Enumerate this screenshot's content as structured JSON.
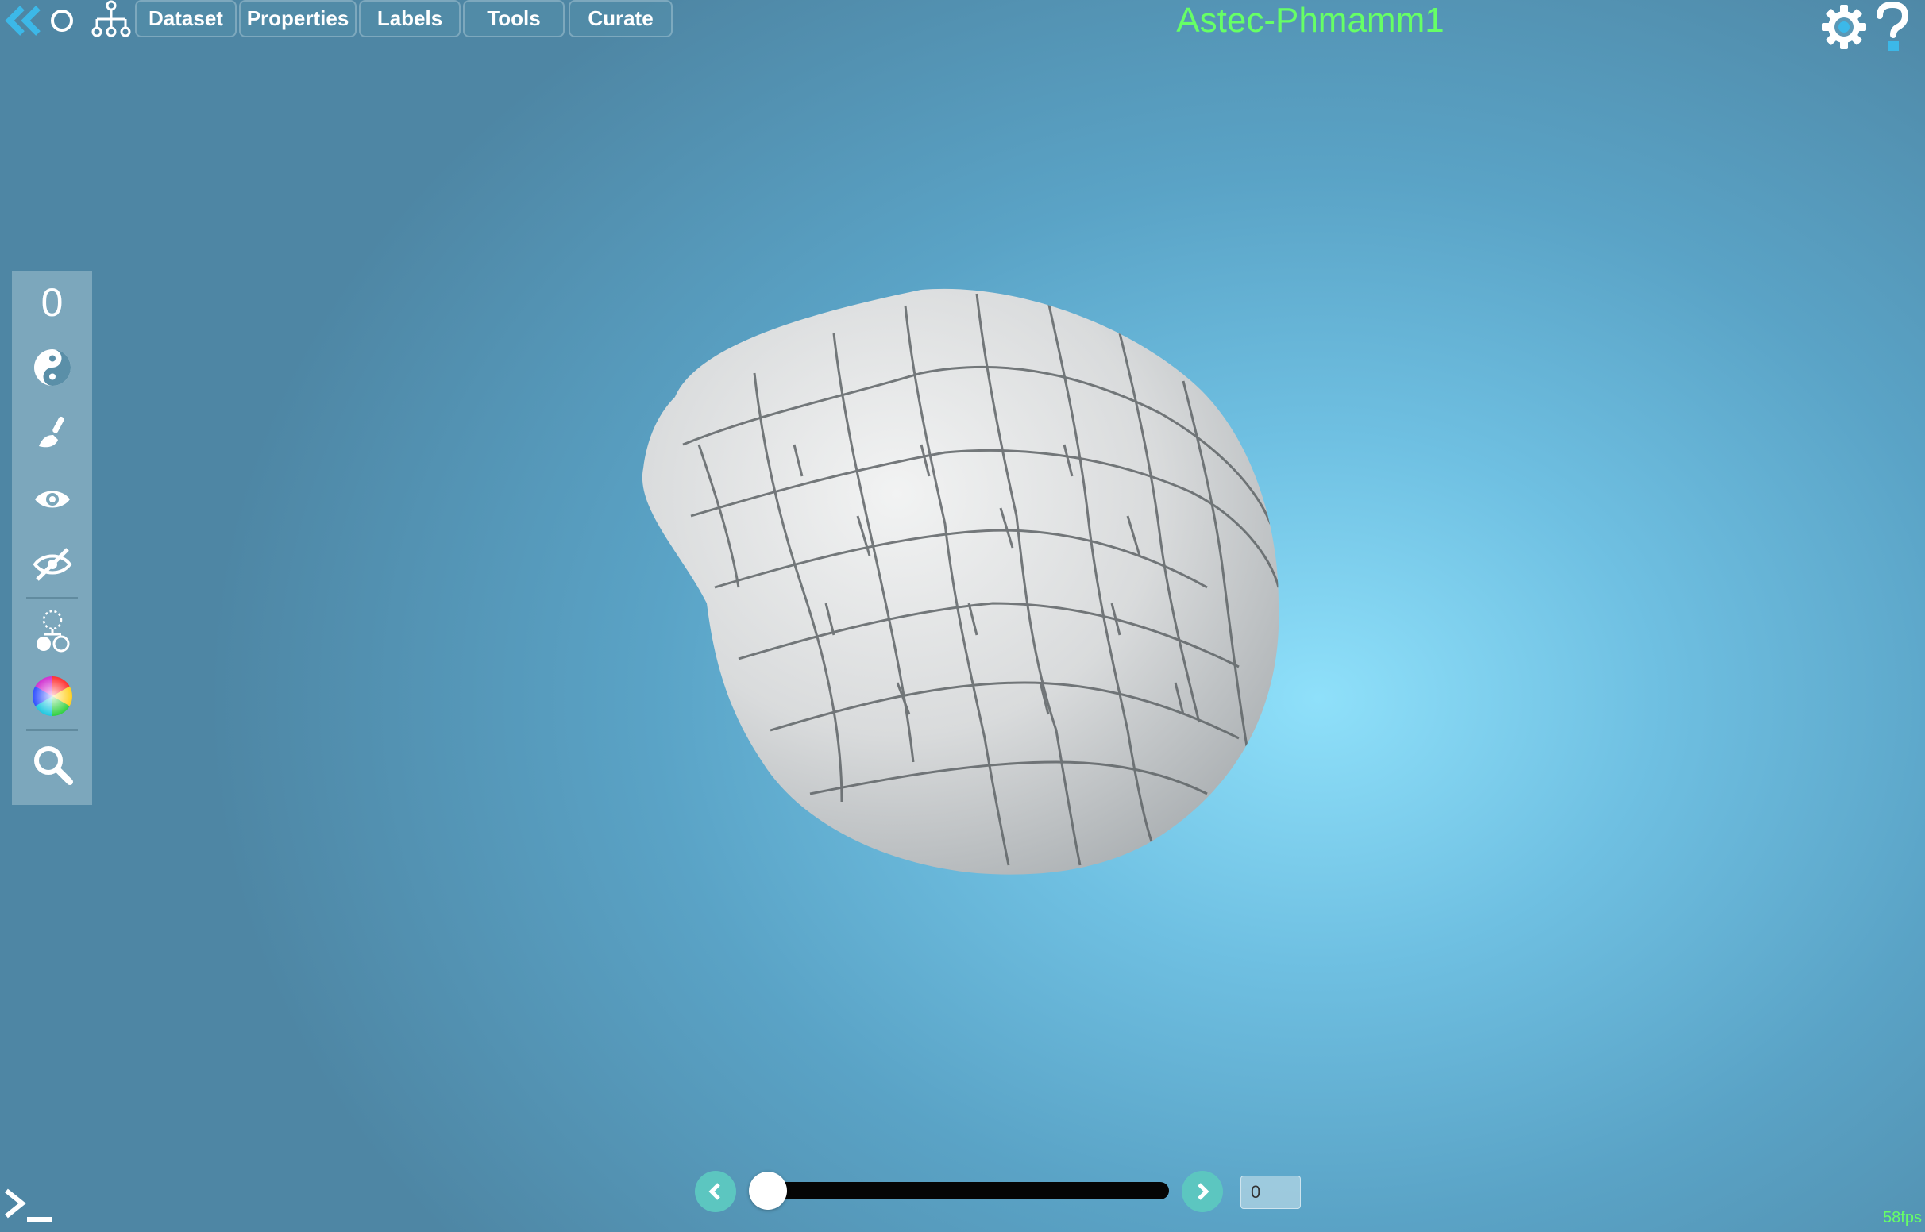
{
  "header": {
    "title": "Astec-Phmamm1",
    "menu": [
      {
        "key": "dataset",
        "label": "Dataset"
      },
      {
        "key": "properties",
        "label": "Properties"
      },
      {
        "key": "labels",
        "label": "Labels"
      },
      {
        "key": "tools",
        "label": "Tools"
      },
      {
        "key": "curate",
        "label": "Curate"
      }
    ],
    "icons": [
      "back-double-chevron-icon",
      "reset-view-circle-icon",
      "lineage-tree-icon",
      "settings-gear-icon",
      "help-question-icon"
    ]
  },
  "left_toolbar": {
    "selected_count": "0",
    "tools": [
      "yin-yang-icon",
      "brush-icon",
      "eye-icon",
      "eye-slash-icon",
      "cell-division-icon",
      "color-wheel-icon",
      "search-icon"
    ]
  },
  "timeline": {
    "value": "0",
    "position_fraction": 0
  },
  "status": {
    "fps": "58fps"
  },
  "colors": {
    "accent_green": "#66ff66",
    "icon_blue": "#3cb8e8",
    "nav_teal": "#5cc6c0"
  }
}
